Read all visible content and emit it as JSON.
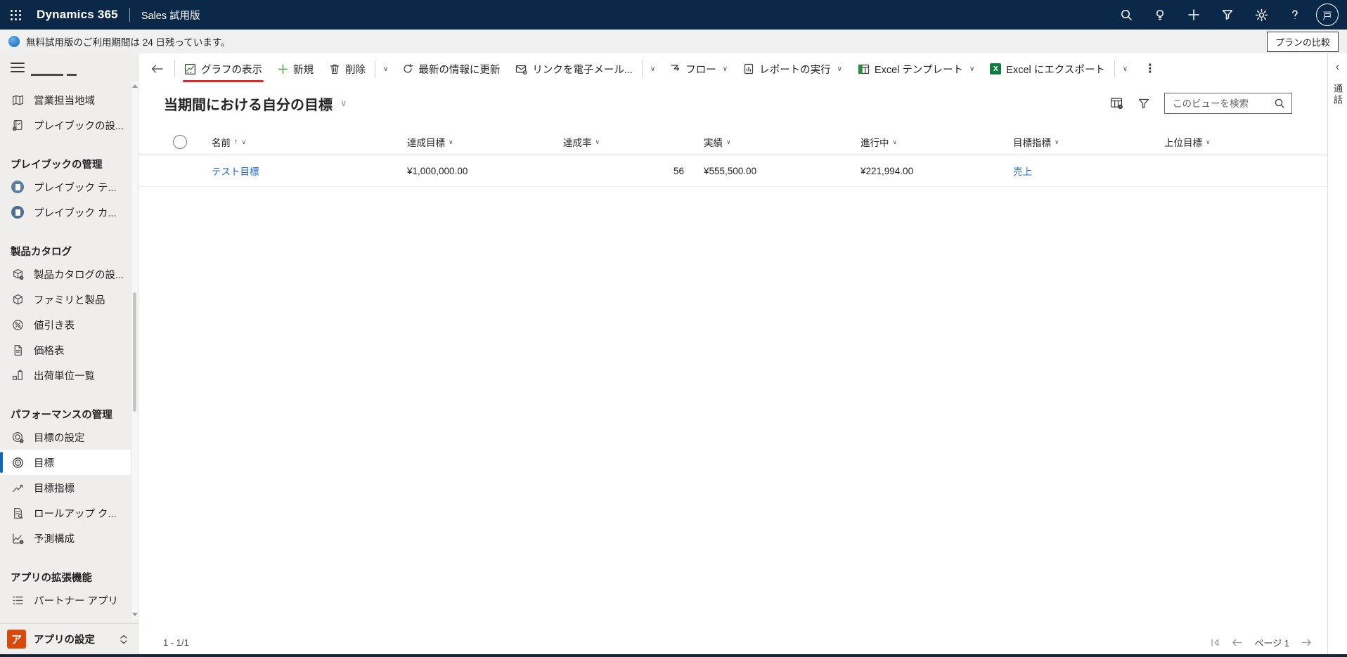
{
  "topbar": {
    "product": "Dynamics 365",
    "app_name": "Sales 試用版",
    "avatar_initial": "戸"
  },
  "notification": {
    "message": "無料試用版のご利用期間は 24 日残っています。",
    "action_label": "プランの比較"
  },
  "commandbar": {
    "show_chart": "グラフの表示",
    "new": "新規",
    "delete": "削除",
    "refresh": "最新の情報に更新",
    "email_link": "リンクを電子メール...",
    "flow": "フロー",
    "run_report": "レポートの実行",
    "excel_templates": "Excel テンプレート",
    "export_excel": "Excel にエクスポート"
  },
  "view": {
    "title": "当期間における自分の目標",
    "search_placeholder": "このビューを検索"
  },
  "grid": {
    "columns": [
      {
        "label": "名前",
        "sort": "asc"
      },
      {
        "label": "達成目標"
      },
      {
        "label": "達成率"
      },
      {
        "label": "実績"
      },
      {
        "label": "進行中"
      },
      {
        "label": "目標指標"
      },
      {
        "label": "上位目標"
      }
    ],
    "rows": [
      {
        "name": "テスト目標",
        "target_value": "¥1,000,000.00",
        "achieved_pct": "56",
        "actual_value": "¥555,500.00",
        "in_progress_value": "¥221,994.00",
        "metric": "売上"
      }
    ]
  },
  "sidebar": {
    "entries": [
      {
        "kind": "item",
        "icon": "map-icon",
        "label": "営業担当地域"
      },
      {
        "kind": "item",
        "icon": "playbook-settings-icon",
        "label": "プレイブックの設..."
      },
      {
        "kind": "header",
        "label": "プレイブックの管理"
      },
      {
        "kind": "item",
        "icon": "playbook-template-icon",
        "label": "プレイブック テ..."
      },
      {
        "kind": "item",
        "icon": "playbook-category-icon",
        "label": "プレイブック カ..."
      },
      {
        "kind": "header",
        "label": "製品カタログ"
      },
      {
        "kind": "item",
        "icon": "product-catalog-settings-icon",
        "label": "製品カタログの設..."
      },
      {
        "kind": "item",
        "icon": "families-products-icon",
        "label": "ファミリと製品"
      },
      {
        "kind": "item",
        "icon": "discount-list-icon",
        "label": "値引き表"
      },
      {
        "kind": "item",
        "icon": "price-list-icon",
        "label": "価格表"
      },
      {
        "kind": "item",
        "icon": "unit-group-icon",
        "label": "出荷単位一覧"
      },
      {
        "kind": "header",
        "label": "パフォーマンスの管理"
      },
      {
        "kind": "item",
        "icon": "goal-settings-icon",
        "label": "目標の設定"
      },
      {
        "kind": "item",
        "icon": "goal-icon",
        "label": "目標",
        "selected": true
      },
      {
        "kind": "item",
        "icon": "goal-metric-icon",
        "label": "目標指標"
      },
      {
        "kind": "item",
        "icon": "rollup-query-icon",
        "label": "ロールアップ ク..."
      },
      {
        "kind": "item",
        "icon": "forecast-icon",
        "label": "予測構成"
      },
      {
        "kind": "header",
        "label": "アプリの拡張機能"
      },
      {
        "kind": "item",
        "icon": "partner-apps-icon",
        "label": "パートナー アプリ"
      }
    ],
    "footer": {
      "badge": "ア",
      "label": "アプリの設定"
    }
  },
  "list_footer": {
    "record_range": "1 - 1/1",
    "page_label": "ページ 1"
  },
  "right_rail": {
    "tab_label": "通話"
  },
  "colors": {
    "topbar_bg": "#0c2848",
    "link_blue": "#2266e3",
    "selected_bar_blue": "#1267b1",
    "annotation_red": "#d92b2b",
    "excel_green": "#107c41",
    "new_plus_green": "#59b359",
    "app_badge_orange": "#d64a0e"
  }
}
